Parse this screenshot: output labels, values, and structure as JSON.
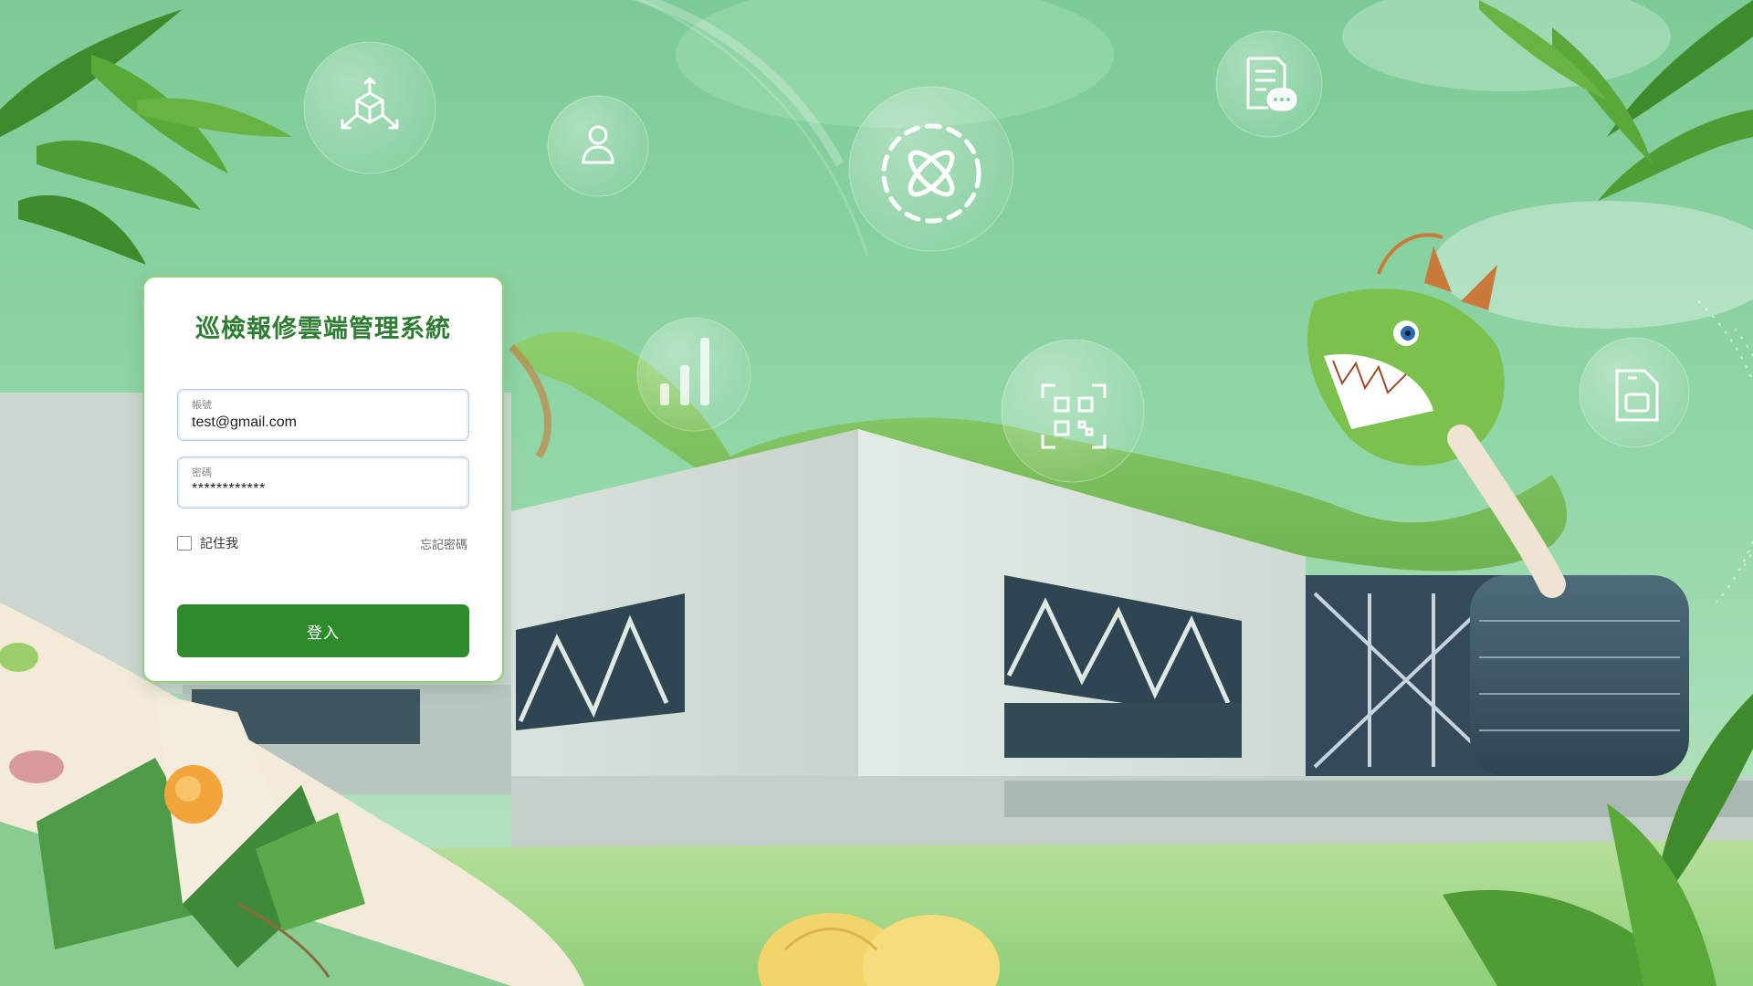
{
  "app": {
    "title": "巡檢報修雲端管理系統"
  },
  "login": {
    "account_label": "帳號",
    "account_value": "test@gmail.com",
    "password_label": "密碼",
    "password_value": "************",
    "remember_label": "記住我",
    "forgot_label": "忘記密碼",
    "submit_label": "登入"
  },
  "background_icons": [
    "cube-network-icon",
    "user-icon",
    "atom-icon",
    "document-chat-icon",
    "bar-chart-icon",
    "qr-code-icon",
    "sim-card-icon"
  ],
  "colors": {
    "brand_green": "#2e8b2c",
    "title_green": "#2e7d32",
    "card_border": "#8fd07a",
    "sky_green": "#7fcf9a"
  }
}
